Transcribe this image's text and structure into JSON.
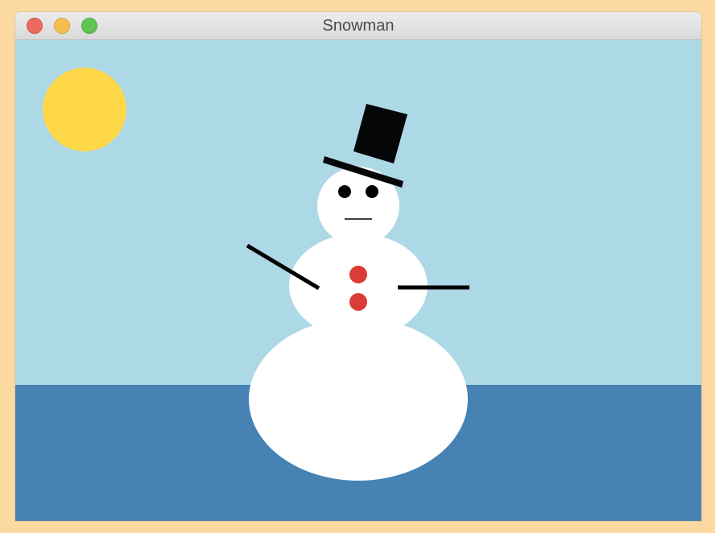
{
  "window": {
    "title": "Snowman"
  },
  "title_bar_buttons": [
    {
      "name": "close",
      "color": "#EC6A5E"
    },
    {
      "name": "minimize",
      "color": "#F5BF4F"
    },
    {
      "name": "zoom",
      "color": "#61C554"
    }
  ],
  "scene": {
    "sky_color": "#ADD8E6",
    "ground_color": "#4682B4",
    "sun_color": "#FFD84A",
    "snow_color": "#FFFFFF",
    "hat_color": "#050608",
    "eye_color": "#000000",
    "button_color": "#DD3B36",
    "arm_color": "#000000"
  }
}
